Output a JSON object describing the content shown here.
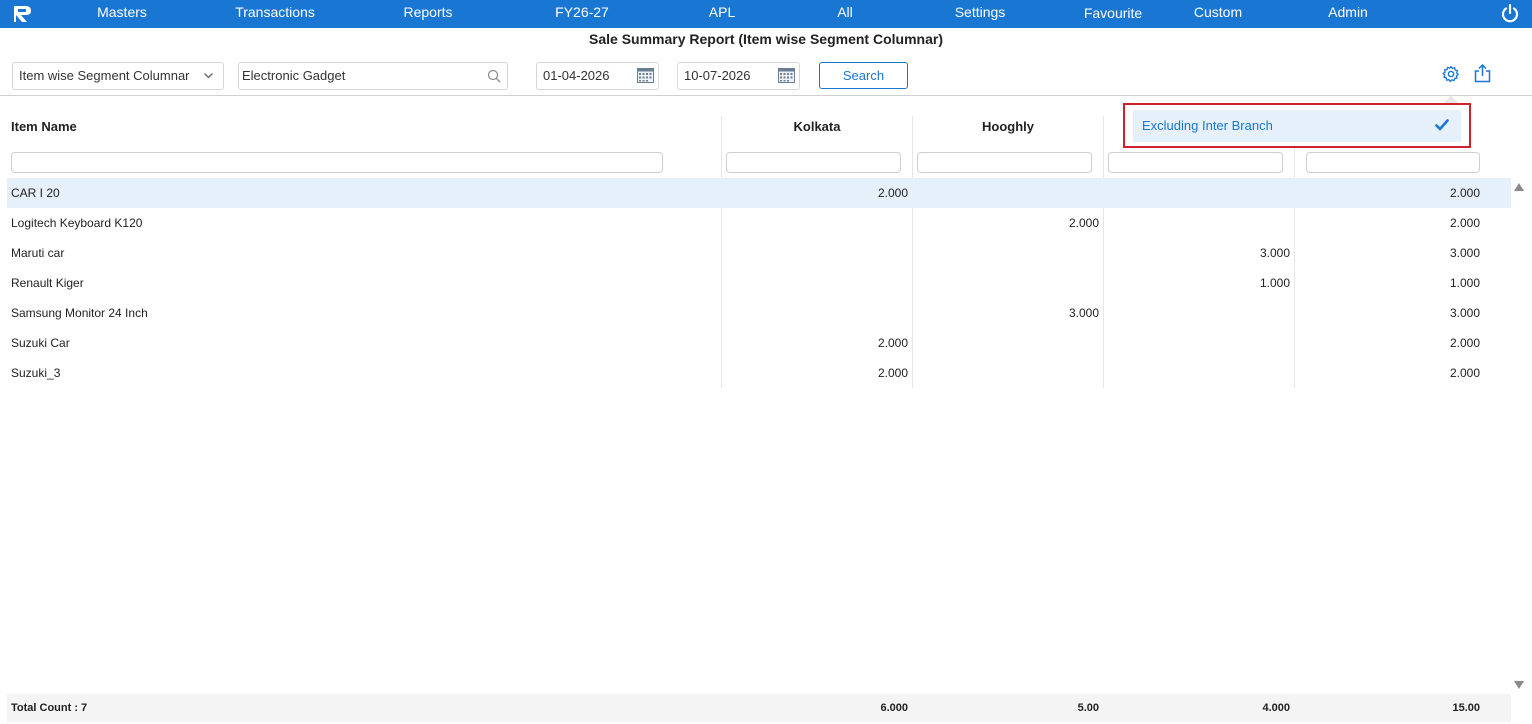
{
  "nav": {
    "items": [
      "Masters",
      "Transactions",
      "Reports",
      "FY26-27",
      "APL",
      "All",
      "Settings",
      "Favourite",
      "Custom",
      "Admin"
    ]
  },
  "report": {
    "title": "Sale Summary Report (Item wise Segment Columnar)"
  },
  "toolbar": {
    "report_type": "Item wise Segment Columnar",
    "group": "Electronic Gadget",
    "from_date": "01-04-2026",
    "to_date": "10-07-2026",
    "search_label": "Search"
  },
  "table": {
    "headers": [
      "Item Name",
      "Kolkata",
      "Hooghly",
      "",
      ""
    ],
    "rows": [
      [
        "CAR I 20",
        "2.000",
        "",
        "",
        "2.000"
      ],
      [
        "Logitech Keyboard K120",
        "",
        "2.000",
        "",
        "2.000"
      ],
      [
        "Maruti car",
        "",
        "",
        "3.000",
        "3.000"
      ],
      [
        "Renault Kiger",
        "",
        "",
        "1.000",
        "1.000"
      ],
      [
        "Samsung Monitor 24 Inch",
        "",
        "3.000",
        "",
        "3.000"
      ],
      [
        "Suzuki Car",
        "2.000",
        "",
        "",
        "2.000"
      ],
      [
        "Suzuki_3",
        "2.000",
        "",
        "",
        "2.000"
      ]
    ],
    "selected_row": 0
  },
  "footer": {
    "total_count": "Total Count : 7",
    "totals": [
      "6.000",
      "5.00",
      "4.000",
      "15.00"
    ]
  },
  "popup": {
    "option_label": "Excluding Inter Branch",
    "checked": true
  },
  "colors": {
    "brand": "#1976d2",
    "highlight_border": "#d0202a",
    "selected_row": "#e6f0fb"
  }
}
